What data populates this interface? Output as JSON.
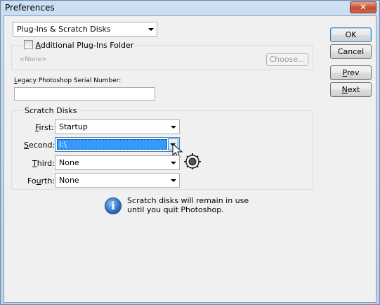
{
  "window": {
    "title": "Preferences",
    "close_glyph": "✕"
  },
  "panel_select": {
    "value": "Plug-Ins & Scratch Disks"
  },
  "plugins": {
    "checkbox_label_prefix": "A",
    "checkbox_label_rest": "dditional Plug-Ins Folder",
    "checked": false,
    "folder_path": "<None>",
    "choose_label": "Choose..."
  },
  "serial": {
    "label": "Legacy Photoshop Serial Number:",
    "value": ""
  },
  "scratch": {
    "group_label": "Scratch Disks",
    "rows": [
      {
        "mnemonic": "F",
        "label_rest": "irst:",
        "value": "Startup"
      },
      {
        "mnemonic": "S",
        "label_rest": "econd:",
        "value": "I:\\"
      },
      {
        "mnemonic": "T",
        "label_rest": "hird:",
        "value": "None"
      },
      {
        "label_start": "Fo",
        "mnemonic": "u",
        "label_rest": "rth:",
        "value": "None"
      }
    ],
    "info_line1": "Scratch disks will remain in use",
    "info_line2": "until you quit Photoshop."
  },
  "buttons": {
    "ok": "OK",
    "cancel": "Cancel",
    "prev": "Prev",
    "next": "Next"
  },
  "colors": {
    "selection": "#3399ff",
    "accent_border": "#3c7fb1"
  }
}
